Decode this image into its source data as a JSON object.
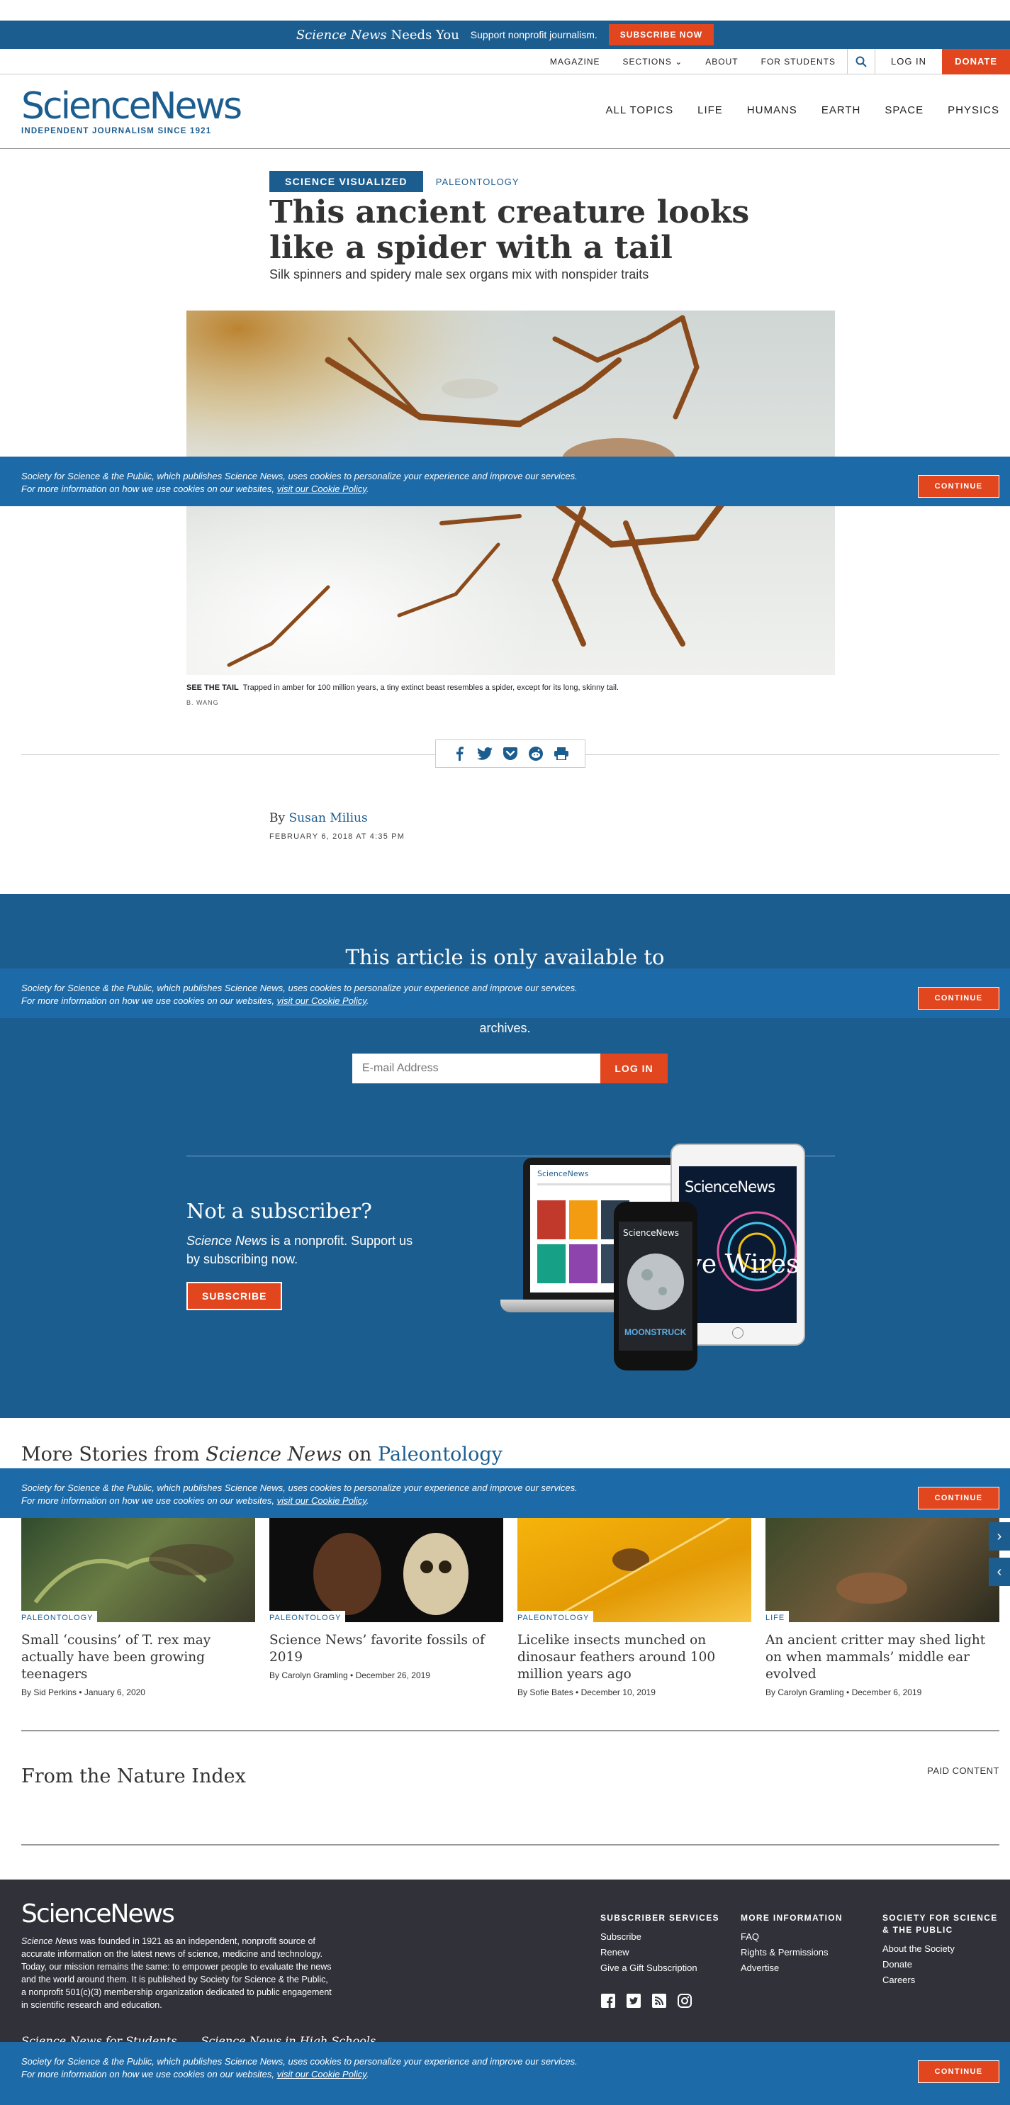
{
  "promo": {
    "title_italic": "Science News",
    "title_rest": "Needs You",
    "text": "Support nonprofit journalism.",
    "button": "SUBSCRIBE NOW"
  },
  "utility_nav": {
    "magazine": "MAGAZINE",
    "sections": "SECTIONS",
    "about": "ABOUT",
    "for_students": "FOR STUDENTS",
    "login": "LOG IN",
    "donate": "DONATE"
  },
  "masthead": {
    "logo": "ScienceNews",
    "tagline": "INDEPENDENT JOURNALISM SINCE 1921",
    "nav": [
      "ALL TOPICS",
      "LIFE",
      "HUMANS",
      "EARTH",
      "SPACE",
      "PHYSICS"
    ]
  },
  "article": {
    "kicker_primary": "SCIENCE VISUALIZED",
    "kicker_secondary": "PALEONTOLOGY",
    "headline": "This ancient creature looks like a spider with a tail",
    "dek": "Silk spinners and spidery male sex organs mix with nonspider traits",
    "caption_label": "SEE THE TAIL",
    "caption_text": "Trapped in amber for 100 million years, a tiny extinct beast resembles a spider, except for its long, skinny tail.",
    "credit": "B. WANG",
    "byline_prefix": "By",
    "author": "Susan Milius",
    "date": "FEBRUARY 6, 2018 AT 4:35 PM"
  },
  "paywall": {
    "title": "This article is only available to",
    "subtitle": "subscribers, enter your e-mail address to access our archives.",
    "email_placeholder": "E-mail Address",
    "login_button": "LOG IN",
    "ns_title": "Not a subscriber?",
    "ns_text_italic": "Science News",
    "ns_text_rest": "is a nonprofit. Support us by subscribing now.",
    "subscribe_button": "SUBSCRIBE",
    "device_logo": "ScienceNews",
    "phone_cover": "MOONSTRUCK",
    "tablet_cover": "ive Wires"
  },
  "cookie": {
    "text": "Society for Science & the Public, which publishes Science News, uses cookies to personalize your experience and improve our services. For more information on how we use cookies on our websites,",
    "link": "visit our Cookie Policy",
    "end": ".",
    "button": "CONTINUE"
  },
  "more_stories": {
    "title_prefix": "More Stories from",
    "title_italic": "Science News",
    "title_on": "on",
    "category": "Paleontology",
    "cards": [
      {
        "tag": "PALEONTOLOGY",
        "title": "Small ‘cousins’ of T. rex may actually have been growing teenagers",
        "meta": "By Sid Perkins • January 6, 2020"
      },
      {
        "tag": "PALEONTOLOGY",
        "title": "Science News’ favorite fossils of 2019",
        "meta": "By Carolyn Gramling • December 26, 2019"
      },
      {
        "tag": "PALEONTOLOGY",
        "title": "Licelike insects munched on dinosaur feathers around 100 million years ago",
        "meta": "By Sofie Bates • December 10, 2019"
      },
      {
        "tag": "LIFE",
        "title": "An ancient critter may shed light on when mammals’ middle ear evolved",
        "meta": "By Carolyn Gramling • December 6, 2019"
      }
    ]
  },
  "nature_index": {
    "title": "From the Nature Index",
    "paid": "PAID CONTENT"
  },
  "footer": {
    "logo": "ScienceNews",
    "about_italic": "Science News",
    "about_rest": "was founded in 1921 as an independent, nonprofit source of accurate information on the latest news of science, medicine and technology. Today, our mission remains the same: to empower people to evaluate the news and the world around them. It is published by Society for Science & the Public, a nonprofit 501(c)(3) membership organization dedicated to public engagement in scientific research and education.",
    "col1_title": "SUBSCRIBER SERVICES",
    "col1": [
      "Subscribe",
      "Renew",
      "Give a Gift Subscription"
    ],
    "col2_title": "MORE INFORMATION",
    "col2": [
      "FAQ",
      "Rights & Permissions",
      "Advertise"
    ],
    "col3_title": "SOCIETY FOR SCIENCE & THE PUBLIC",
    "col3": [
      "About the Society",
      "Donate",
      "Careers"
    ],
    "links": [
      "Science News for Students",
      "Science News in High Schools"
    ]
  },
  "icons": [
    "facebook-icon",
    "twitter-icon",
    "pocket-icon",
    "reddit-icon",
    "print-icon",
    "search-icon"
  ],
  "colors": {
    "brand_blue": "#1c5d90",
    "accent_orange": "#e1461f",
    "footer_bg": "#303139"
  }
}
